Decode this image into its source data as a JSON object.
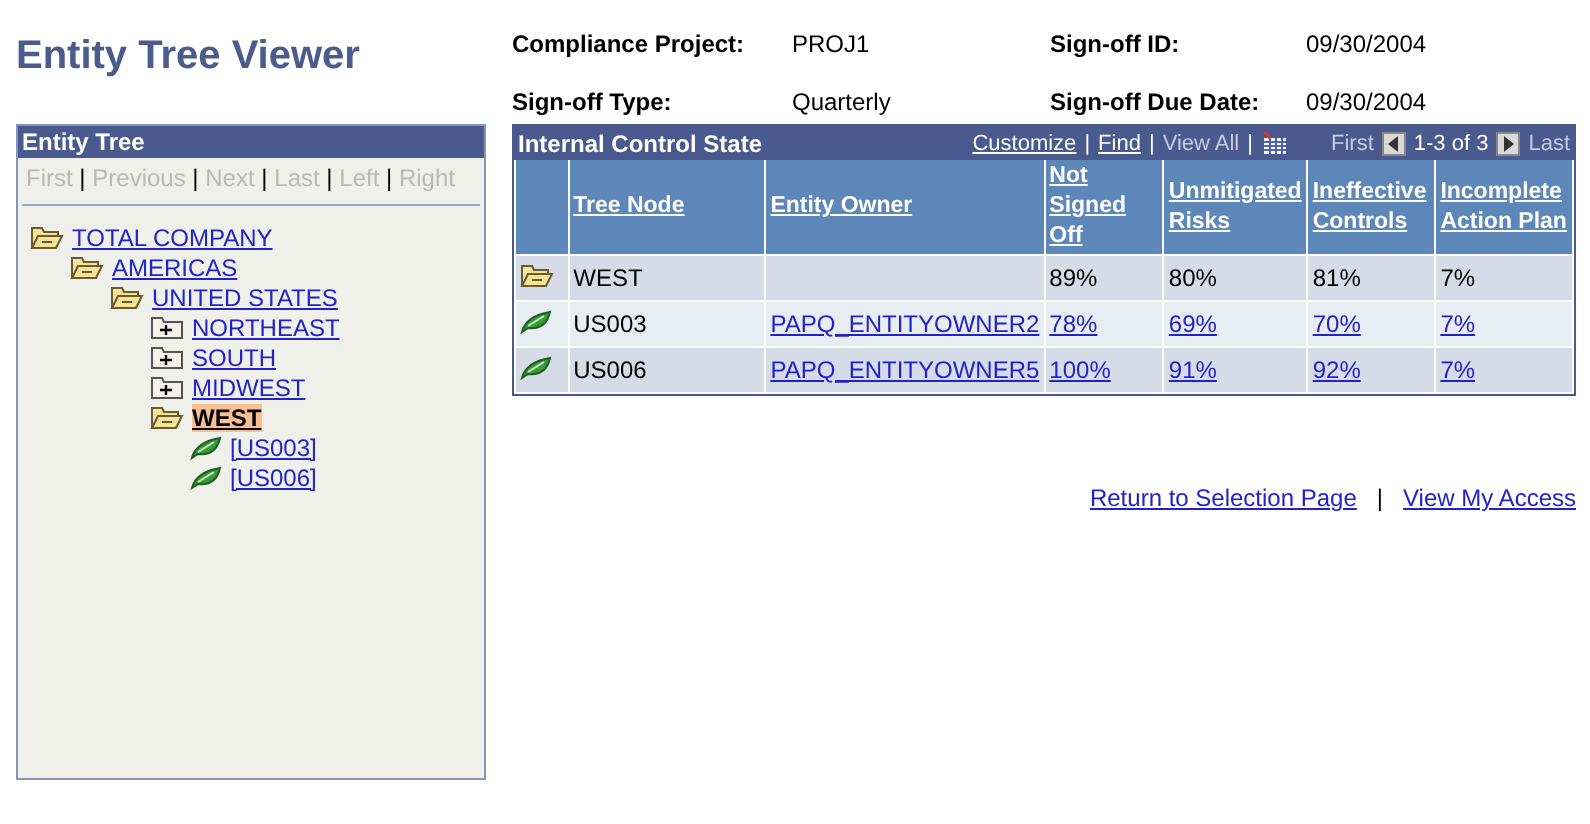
{
  "page_title": "Entity Tree Viewer",
  "summary": [
    {
      "label": "Compliance Project:",
      "value": "PROJ1"
    },
    {
      "label": "Sign-off ID:",
      "value": "09/30/2004"
    },
    {
      "label": "Sign-off Type:",
      "value": "Quarterly"
    },
    {
      "label": "Sign-off Due Date:",
      "value": "09/30/2004"
    }
  ],
  "tree_panel": {
    "title": "Entity Tree",
    "separator": "|",
    "nav": [
      {
        "label": "First",
        "disabled": true
      },
      {
        "label": "Previous",
        "disabled": true
      },
      {
        "label": "Next",
        "disabled": true
      },
      {
        "label": "Last",
        "disabled": true
      },
      {
        "label": "Left",
        "disabled": true
      },
      {
        "label": "Right",
        "disabled": true
      }
    ],
    "nodes": [
      {
        "label": "TOTAL COMPANY",
        "kind": "folder",
        "expanded": true,
        "selected": false,
        "children": [
          {
            "label": "AMERICAS",
            "kind": "folder",
            "expanded": true,
            "selected": false,
            "children": [
              {
                "label": "UNITED STATES",
                "kind": "folder",
                "expanded": true,
                "selected": false,
                "children": [
                  {
                    "label": "NORTHEAST",
                    "kind": "folder",
                    "expanded": false,
                    "selected": false
                  },
                  {
                    "label": "SOUTH",
                    "kind": "folder",
                    "expanded": false,
                    "selected": false
                  },
                  {
                    "label": "MIDWEST",
                    "kind": "folder",
                    "expanded": false,
                    "selected": false
                  },
                  {
                    "label": "WEST",
                    "kind": "folder",
                    "expanded": true,
                    "selected": true,
                    "children": [
                      {
                        "label": "[US003]",
                        "kind": "leaf",
                        "selected": false
                      },
                      {
                        "label": "[US006]",
                        "kind": "leaf",
                        "selected": false
                      }
                    ]
                  }
                ]
              }
            ]
          }
        ]
      }
    ]
  },
  "grid": {
    "title": "Internal Control State",
    "separator": "|",
    "tools": [
      "Customize",
      "Find",
      "View All"
    ],
    "first": "First",
    "range": "1-3 of 3",
    "last": "Last",
    "columns": [
      "Tree Node",
      "Entity Owner",
      "Not Signed Off",
      "Unmitigated Risks",
      "Ineffective Controls",
      "Incomplete Action Plan"
    ],
    "rows": [
      {
        "kind": "folder",
        "cells": [
          {
            "text": "WEST",
            "link": false
          },
          {},
          {
            "text": "89%",
            "link": false
          },
          {
            "text": "80%",
            "link": false
          },
          {
            "text": "81%",
            "link": false
          },
          {
            "text": "7%",
            "link": false
          }
        ]
      },
      {
        "kind": "leaf",
        "cells": [
          {
            "text": "US003",
            "link": false
          },
          {
            "text": "PAPQ_ENTITYOWNER2",
            "link": true
          },
          {
            "text": "78%",
            "link": true
          },
          {
            "text": "69%",
            "link": true
          },
          {
            "text": "70%",
            "link": true
          },
          {
            "text": "7%",
            "link": true
          }
        ]
      },
      {
        "kind": "leaf",
        "cells": [
          {
            "text": "US006",
            "link": false
          },
          {
            "text": "PAPQ_ENTITYOWNER5",
            "link": true
          },
          {
            "text": "100%",
            "link": true
          },
          {
            "text": "91%",
            "link": true
          },
          {
            "text": "92%",
            "link": true
          },
          {
            "text": "7%",
            "link": true
          }
        ]
      }
    ]
  },
  "links": [
    {
      "label": "Return to Selection Page"
    },
    {
      "separator": "|"
    },
    {
      "label": "View My Access"
    }
  ]
}
